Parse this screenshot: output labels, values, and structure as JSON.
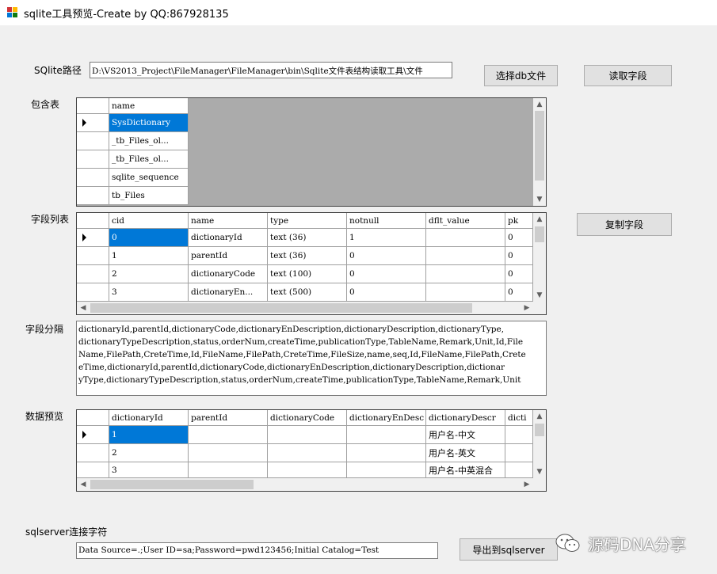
{
  "window": {
    "title": "sqlite工具预览-Create by QQ:867928135"
  },
  "path_label": "SQlite路径",
  "path_value": "D:\\VS2013_Project\\FileManager\\FileManager\\bin\\Sqlite文件表结构读取工具\\文件",
  "buttons": {
    "choose_db": "选择db文件",
    "read_fields": "读取字段",
    "copy_fields": "复制字段",
    "export": "导出到sqlserver"
  },
  "tables_label": "包含表",
  "tables_grid": {
    "header": "name",
    "rows": [
      "SysDictionary",
      "_tb_Files_ol...",
      "_tb_Files_ol...",
      "sqlite_sequence",
      "tb_Files"
    ]
  },
  "fields_label": "字段列表",
  "fields_grid": {
    "headers": [
      "cid",
      "name",
      "type",
      "notnull",
      "dflt_value",
      "pk"
    ],
    "rows": [
      [
        "0",
        "dictionaryId",
        "text (36)",
        "1",
        "",
        "0"
      ],
      [
        "1",
        "parentId",
        "text (36)",
        "0",
        "",
        "0"
      ],
      [
        "2",
        "dictionaryCode",
        "text (100)",
        "0",
        "",
        "0"
      ],
      [
        "3",
        "dictionaryEn...",
        "text (500)",
        "0",
        "",
        "0"
      ]
    ]
  },
  "separator_label": "字段分隔",
  "separator_lines": [
    "dictionaryId,parentId,dictionaryCode,dictionaryEnDescription,dictionaryDescription,dictionaryType,",
    "dictionaryTypeDescription,status,orderNum,createTime,publicationType,TableName,Remark,Unit,Id,File",
    "Name,FilePath,CreteTime,Id,FileName,FilePath,CreteTime,FileSize,name,seq,Id,FileName,FilePath,Crete",
    "eTime,dictionaryId,parentId,dictionaryCode,dictionaryEnDescription,dictionaryDescription,dictionar",
    "yType,dictionaryTypeDescription,status,orderNum,createTime,publicationType,TableName,Remark,Unit"
  ],
  "preview_label": "数据预览",
  "preview_grid": {
    "headers": [
      "dictionaryId",
      "parentId",
      "dictionaryCode",
      "dictionaryEnDesc",
      "dictionaryDescr",
      "dicti"
    ],
    "rows": [
      [
        "1",
        "",
        "",
        "",
        "用户名-中文",
        ""
      ],
      [
        "2",
        "",
        "",
        "",
        "用户名-英文",
        ""
      ],
      [
        "3",
        "",
        "",
        "",
        "用户名-中英混合",
        ""
      ]
    ]
  },
  "conn_label": "sqlserver连接字符",
  "conn_value": "Data Source=.;User ID=sa;Password=pwd123456;Initial Catalog=Test",
  "watermark": "源码DNA分享"
}
